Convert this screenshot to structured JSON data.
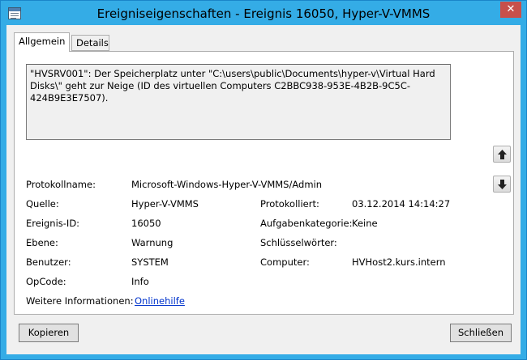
{
  "window": {
    "title": "Ereigniseigenschaften - Ereignis 16050, Hyper-V-VMMS",
    "close_glyph": "✕"
  },
  "tabs": [
    {
      "label": "Allgemein",
      "active": true
    },
    {
      "label": "Details",
      "active": false
    }
  ],
  "description": "\"HVSRV001\": Der Speicherplatz unter \"C:\\users\\public\\Documents\\hyper-v\\Virtual Hard Disks\\\" geht zur Neige (ID des virtuellen Computers C2BBC938-953E-4B2B-9C5C-424B9E3E7507).",
  "fields": {
    "protokollname": {
      "label": "Protokollname:",
      "value": "Microsoft-Windows-Hyper-V-VMMS/Admin"
    },
    "quelle": {
      "label": "Quelle:",
      "value": "Hyper-V-VMMS"
    },
    "protokolliert": {
      "label": "Protokolliert:",
      "value": "03.12.2014 14:14:27"
    },
    "ereignis_id": {
      "label": "Ereignis-ID:",
      "value": "16050"
    },
    "aufgabenkategorie": {
      "label": "Aufgabenkategorie:",
      "value": "Keine"
    },
    "ebene": {
      "label": "Ebene:",
      "value": "Warnung"
    },
    "schluesselwoerter": {
      "label": "Schlüsselwörter:",
      "value": ""
    },
    "benutzer": {
      "label": "Benutzer:",
      "value": "SYSTEM"
    },
    "computer": {
      "label": "Computer:",
      "value": "HVHost2.kurs.intern"
    },
    "opcode": {
      "label": "OpCode:",
      "value": "Info"
    },
    "weitere": {
      "label": "Weitere Informationen:",
      "value": "Onlinehilfe"
    }
  },
  "buttons": {
    "copy": "Kopieren",
    "close": "Schließen"
  },
  "colors": {
    "title_bar": "#34ace6",
    "close_button": "#c7504b",
    "link": "#0033cc"
  }
}
